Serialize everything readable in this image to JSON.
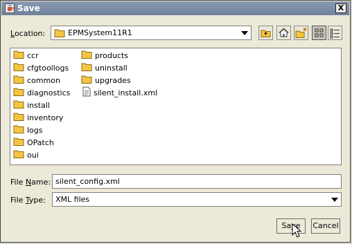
{
  "window": {
    "title": "Save",
    "close_symbol": "X",
    "icon": "java-cup-icon"
  },
  "location": {
    "label_prefix": "",
    "label_hotkey": "L",
    "label_rest": "ocation:",
    "value": "EPMSystem11R1",
    "folder_icon": "folder-icon"
  },
  "toolbar": {
    "buttons": [
      "up-one-level-icon",
      "home-icon",
      "new-folder-icon",
      "list-view-icon",
      "details-view-icon"
    ]
  },
  "files": {
    "column1": [
      "ccr",
      "cfgtoollogs",
      "common",
      "diagnostics",
      "install",
      "inventory",
      "logs",
      "OPatch",
      "oui"
    ],
    "column2_folders": [
      "products",
      "uninstall",
      "upgrades"
    ],
    "column2_files": [
      "silent_install.xml"
    ]
  },
  "filename": {
    "label_prefix": "File ",
    "label_hotkey": "N",
    "label_rest": "ame:",
    "value": "silent_config.xml"
  },
  "filetype": {
    "label_prefix": "File ",
    "label_hotkey": "T",
    "label_rest": "ype:",
    "value": "XML files"
  },
  "buttons": {
    "save_prefix": "Sa",
    "save_hotkey": "v",
    "save_rest": "e",
    "cancel": "Cancel"
  },
  "colors": {
    "folder": "#f5c542",
    "title_bar": "#7c8ea6"
  }
}
